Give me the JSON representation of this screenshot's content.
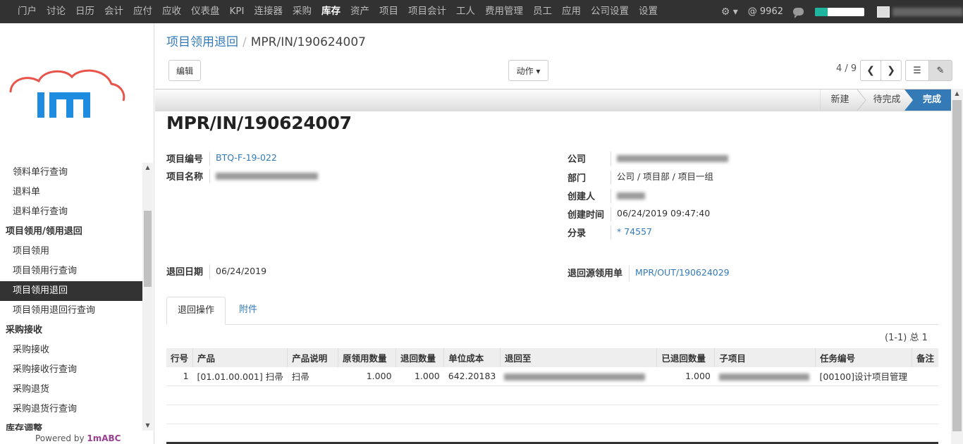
{
  "topnav": {
    "items": [
      "门户",
      "讨论",
      "日历",
      "会计",
      "应付",
      "应收",
      "仪表盘",
      "KPI",
      "连接器",
      "采购",
      "库存",
      "资产",
      "项目",
      "项目会计",
      "工人",
      "费用管理",
      "员工",
      "应用",
      "公司设置",
      "设置"
    ],
    "active_index": 10,
    "mention_count": "@ 9962",
    "progress_fraction": 0.25
  },
  "sidebar": {
    "items": [
      {
        "label": "领料单行查询",
        "type": "item"
      },
      {
        "label": "退料单",
        "type": "item"
      },
      {
        "label": "退料单行查询",
        "type": "item"
      },
      {
        "label": "项目领用/领用退回",
        "type": "header"
      },
      {
        "label": "项目领用",
        "type": "item"
      },
      {
        "label": "项目领用行查询",
        "type": "item"
      },
      {
        "label": "项目领用退回",
        "type": "item",
        "active": true
      },
      {
        "label": "项目领用退回行查询",
        "type": "item"
      },
      {
        "label": "采购接收",
        "type": "header"
      },
      {
        "label": "采购接收",
        "type": "item"
      },
      {
        "label": "采购接收行查询",
        "type": "item"
      },
      {
        "label": "采购退货",
        "type": "item"
      },
      {
        "label": "采购退货行查询",
        "type": "item"
      },
      {
        "label": "库存调整",
        "type": "header"
      }
    ],
    "powered_prefix": "Powered by ",
    "powered_brand": "1mABC"
  },
  "breadcrumb": {
    "parent": "项目领用退回",
    "separator": "/",
    "current": "MPR/IN/190624007"
  },
  "toolbar": {
    "edit_label": "编辑",
    "action_label": "动作 ▾",
    "pager": "4 / 9"
  },
  "stages": [
    "新建",
    "待完成",
    "完成"
  ],
  "form": {
    "title": "MPR/IN/190624007",
    "project_code_label": "项目编号",
    "project_code": "BTQ-F-19-022",
    "project_name_label": "项目名称",
    "company_label": "公司",
    "department_label": "部门",
    "department": "公司 / 项目部 / 项目一组",
    "creator_label": "创建人",
    "created_time_label": "创建时间",
    "created_time": "06/24/2019 09:47:40",
    "entry_label": "分录",
    "entry": "* 74557",
    "return_date_label": "退回日期",
    "return_date": "06/24/2019",
    "source_label": "退回源领用单",
    "source": "MPR/OUT/190624029"
  },
  "tabs": [
    "退回操作",
    "附件"
  ],
  "record_count": "(1-1) 总 1",
  "table": {
    "headers": [
      "行号",
      "产品",
      "产品说明",
      "原领用数量",
      "退回数量",
      "单位成本",
      "退回至",
      "已退回数量",
      "子项目",
      "任务编号",
      "备注"
    ],
    "rows": [
      {
        "line": "1",
        "product": "[01.01.00.001] 扫帚",
        "desc": "扫帚",
        "orig_qty": "1.000",
        "ret_qty": "1.000",
        "unit_cost": "642.20183",
        "returned_qty": "1.000",
        "task": "[00100]设计项目管理"
      }
    ]
  },
  "colors": {
    "topbar": "#323232",
    "link": "#337ab7",
    "stage_done": "#337ab7",
    "progress": "#1fb59f",
    "brand": "#9b3f93"
  }
}
